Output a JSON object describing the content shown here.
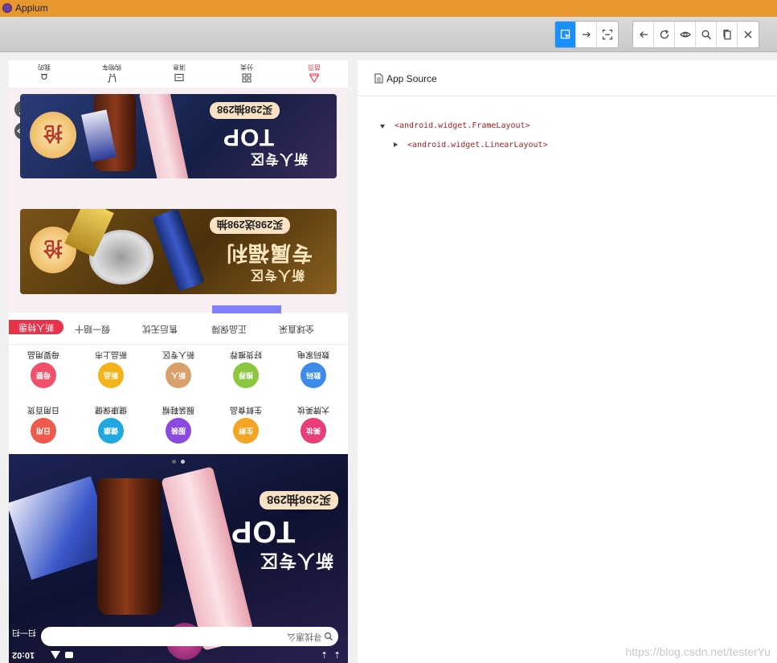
{
  "window": {
    "title": "Appium"
  },
  "toolbar": {
    "left_icons": [
      "select-element-icon",
      "swipe-icon",
      "tap-by-coordinates-icon"
    ],
    "right_icons": [
      "back-icon",
      "refresh-icon",
      "eye-icon",
      "search-icon",
      "copy-xml-icon",
      "close-icon"
    ]
  },
  "device": {
    "status_time": "10:02",
    "search_placeholder": "寻找惠么",
    "scan_label": "扫一扫",
    "banner_main": {
      "headline": "新人专区",
      "brand": "TOP",
      "promo": "买298抽298"
    },
    "nav_tabs": [
      "我的",
      "购物车",
      "消息",
      "分类",
      "首页"
    ],
    "banner1": {
      "headline": "新人专区",
      "brand": "TOP",
      "promo": "买298抽298"
    },
    "banner2": {
      "headline": "新人专区",
      "subline": "专属福利",
      "promo": "买298送298抽"
    },
    "services": [
      "全球直采",
      "正品保障",
      "售后无忧",
      "假一赔十"
    ],
    "service_badge": "新人特惠",
    "categories_row1": [
      "数码家电",
      "好货推荐",
      "新人专区",
      "新品上市",
      "母婴用品"
    ],
    "categories_row2": [
      "大牌美妆",
      "生鲜食品",
      "服装鞋帽",
      "健康保健",
      "日用百货"
    ],
    "category_glyphs_row1": [
      "数码",
      "推荐",
      "新人",
      "新品",
      "母婴"
    ],
    "category_glyphs_row2": [
      "美妆",
      "生鲜",
      "服装",
      "健康",
      "日用"
    ],
    "colors": {
      "accent": "#1890ff",
      "titlebar": "#e8962e",
      "highlight": "#8080ff",
      "badge": "#e8344a"
    }
  },
  "source": {
    "title": "App Source",
    "nodes": [
      "<android.widget.FrameLayout>",
      "<android.widget.LinearLayout>"
    ]
  },
  "watermark": "https://blog.csdn.net/testerYu"
}
